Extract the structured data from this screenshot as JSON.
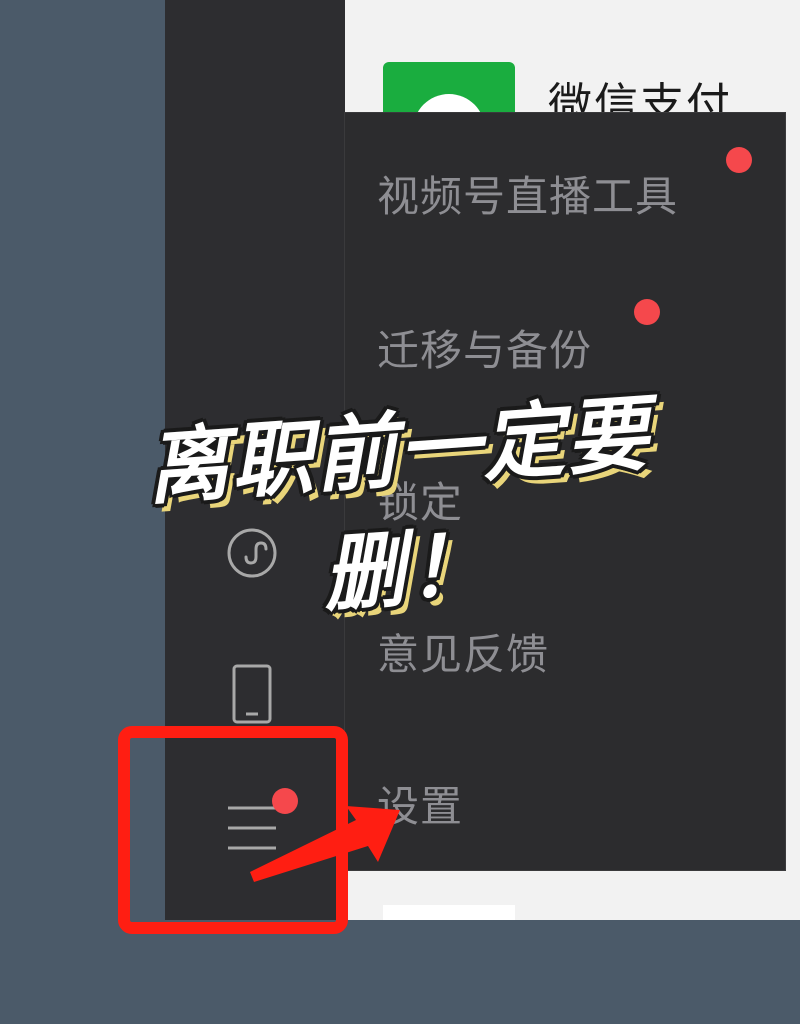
{
  "background_color": "#4b5a69",
  "header": {
    "wechat_pay_title": "微信支付"
  },
  "menu": {
    "items": [
      {
        "label": "视频号直播工具",
        "badge": true
      },
      {
        "label": "迁移与备份",
        "badge": true
      },
      {
        "label": "锁定",
        "badge": false
      },
      {
        "label": "意见反馈",
        "badge": false
      },
      {
        "label": "设置",
        "badge": false
      }
    ]
  },
  "sidebar": {
    "icons": [
      "mini-program-icon",
      "phone-icon",
      "hamburger-menu-icon"
    ],
    "menu_badge": true
  },
  "overlay": {
    "banner_text": "离职前一定要删！",
    "highlight_color": "#ff1e12",
    "badge_color": "#f5484c"
  }
}
